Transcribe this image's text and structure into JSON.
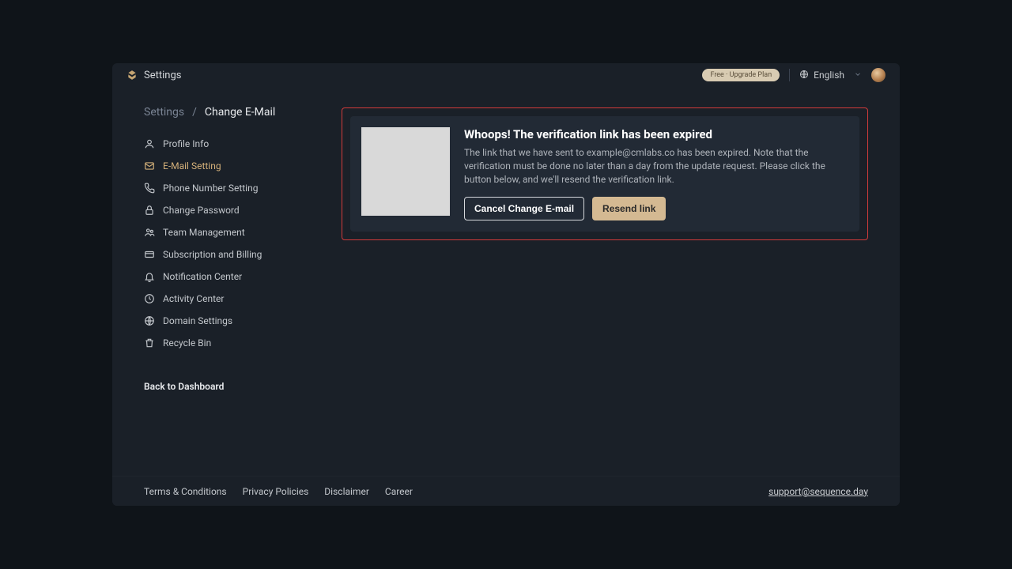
{
  "header": {
    "title": "Settings",
    "plan_pill": "Free · Upgrade Plan",
    "language": "English"
  },
  "breadcrumb": {
    "root": "Settings",
    "sep": "/",
    "current": "Change E-Mail"
  },
  "sidebar": {
    "items": [
      {
        "label": "Profile Info",
        "icon": "user-icon"
      },
      {
        "label": "E-Mail Setting",
        "icon": "mail-icon",
        "active": true
      },
      {
        "label": "Phone Number Setting",
        "icon": "phone-icon"
      },
      {
        "label": "Change Password",
        "icon": "lock-icon"
      },
      {
        "label": "Team Management",
        "icon": "team-icon"
      },
      {
        "label": "Subscription and Billing",
        "icon": "card-icon"
      },
      {
        "label": "Notification Center",
        "icon": "bell-icon"
      },
      {
        "label": "Activity Center",
        "icon": "clock-icon"
      },
      {
        "label": "Domain Settings",
        "icon": "globe-icon"
      },
      {
        "label": "Recycle Bin",
        "icon": "trash-icon"
      }
    ],
    "back_label": "Back to Dashboard"
  },
  "alert": {
    "title": "Whoops! The verification link has been expired",
    "body": "The link that we have sent to example@cmlabs.co has been expired. Note that the verification must be done no later than a day from the update request. Please click the button below, and we'll resend the verification link.",
    "cancel_label": "Cancel Change E-mail",
    "resend_label": "Resend link"
  },
  "footer": {
    "links": [
      "Terms & Conditions",
      "Privacy Policies",
      "Disclaimer",
      "Career"
    ],
    "support": "support@sequence.day"
  }
}
